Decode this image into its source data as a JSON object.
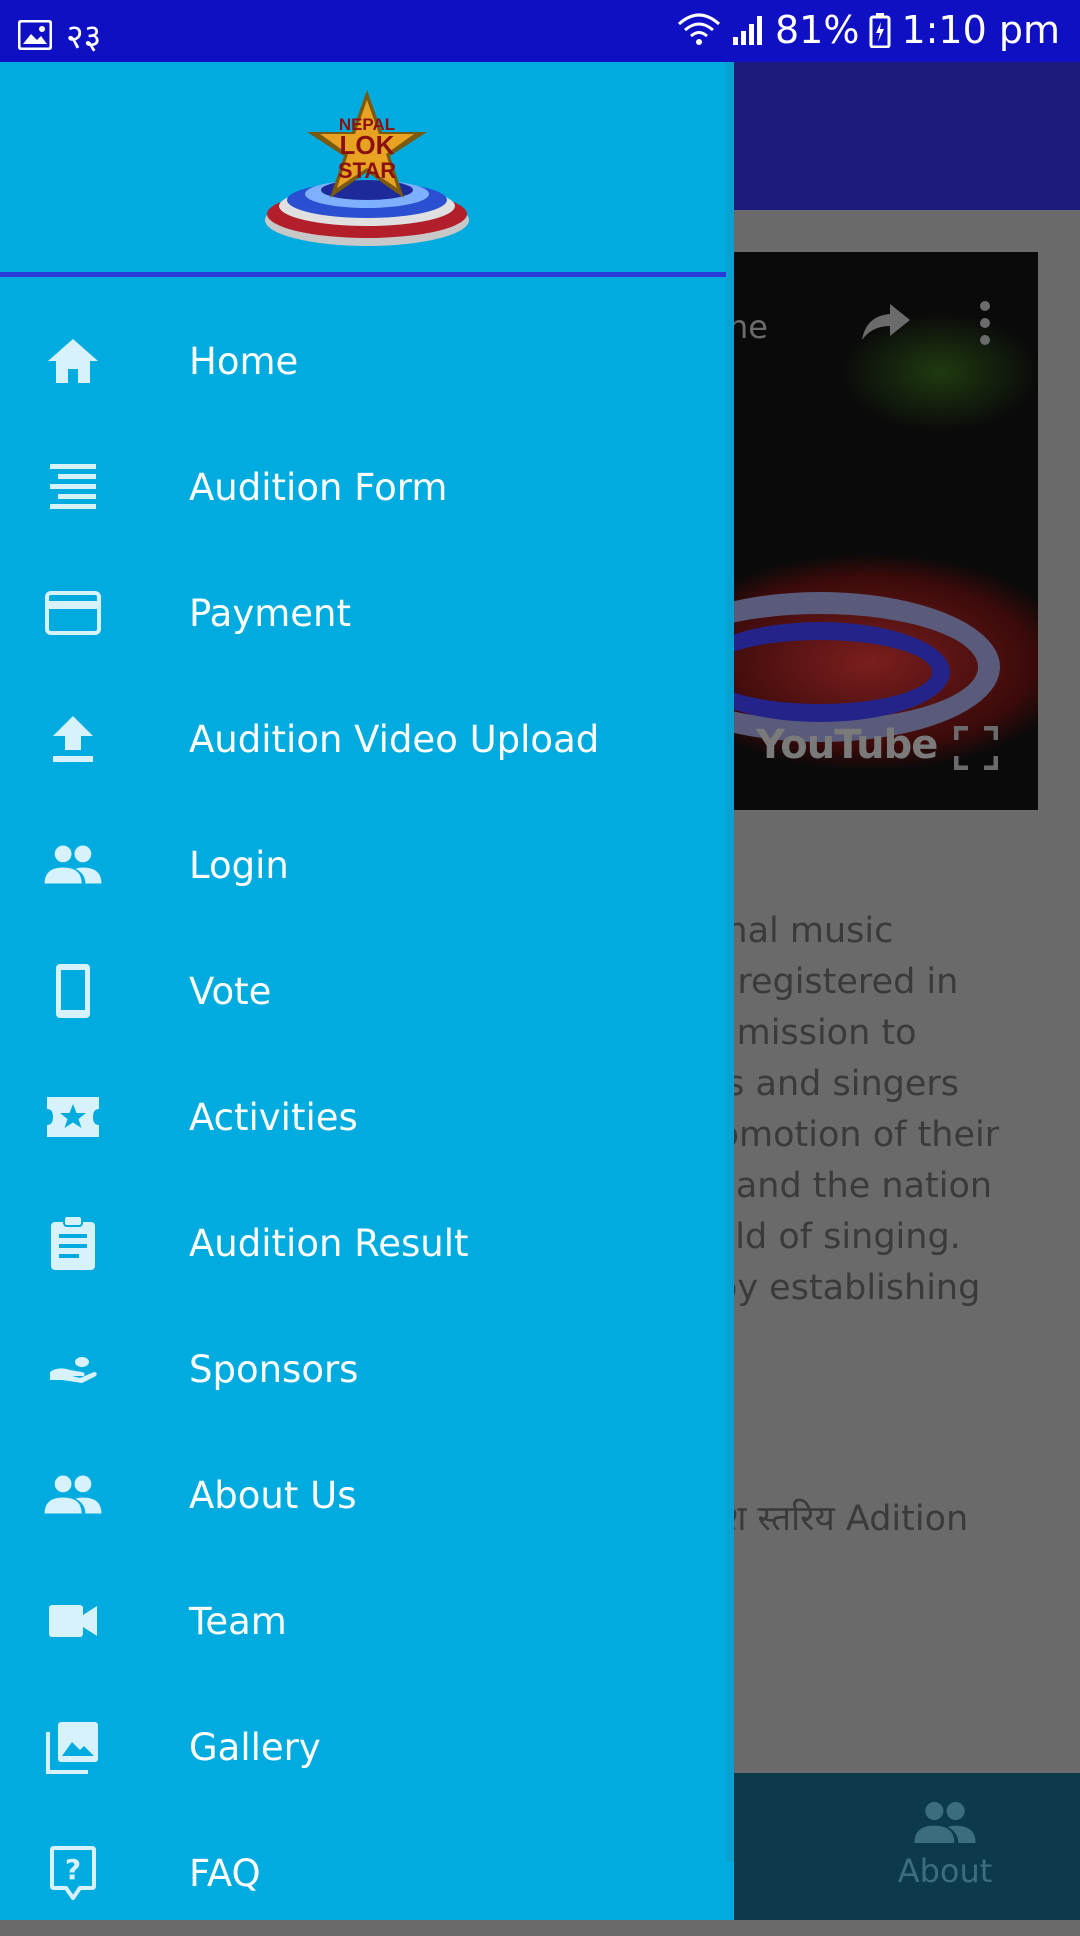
{
  "status_bar": {
    "left_badge": "२३",
    "battery": "81%",
    "time": "1:10 pm"
  },
  "video": {
    "title_fragment": "ne",
    "youtube_label": "YouTube"
  },
  "background_text": {
    "paragraph": "onal music\ng registered in\ne mission to\nns and singers\nromotion of their\ny and the nation\nield of singing.\n by establishing",
    "line2": "देश स्तरिय Adition"
  },
  "bottom_nav": {
    "about_label": "About"
  },
  "drawer": {
    "logo_text": [
      "NEPAL",
      "LOK",
      "STAR"
    ],
    "items": [
      {
        "label": "Home",
        "icon": "home-icon"
      },
      {
        "label": "Audition Form",
        "icon": "form-lines-icon"
      },
      {
        "label": "Payment",
        "icon": "credit-card-icon"
      },
      {
        "label": "Audition Video Upload",
        "icon": "upload-icon"
      },
      {
        "label": "Login",
        "icon": "people-icon"
      },
      {
        "label": "Vote",
        "icon": "phone-icon"
      },
      {
        "label": "Activities",
        "icon": "ticket-star-icon"
      },
      {
        "label": "Audition Result",
        "icon": "clipboard-icon"
      },
      {
        "label": "Sponsors",
        "icon": "hand-coin-icon"
      },
      {
        "label": "About Us",
        "icon": "people-icon"
      },
      {
        "label": "Team",
        "icon": "videocam-icon"
      },
      {
        "label": "Gallery",
        "icon": "photo-library-icon"
      },
      {
        "label": "FAQ",
        "icon": "help-bubble-icon"
      }
    ]
  },
  "colors": {
    "status_bar": "#0f10c4",
    "drawer": "#00acdf",
    "header_divider": "#2a3ad8",
    "icon": "#d8f2fb"
  }
}
